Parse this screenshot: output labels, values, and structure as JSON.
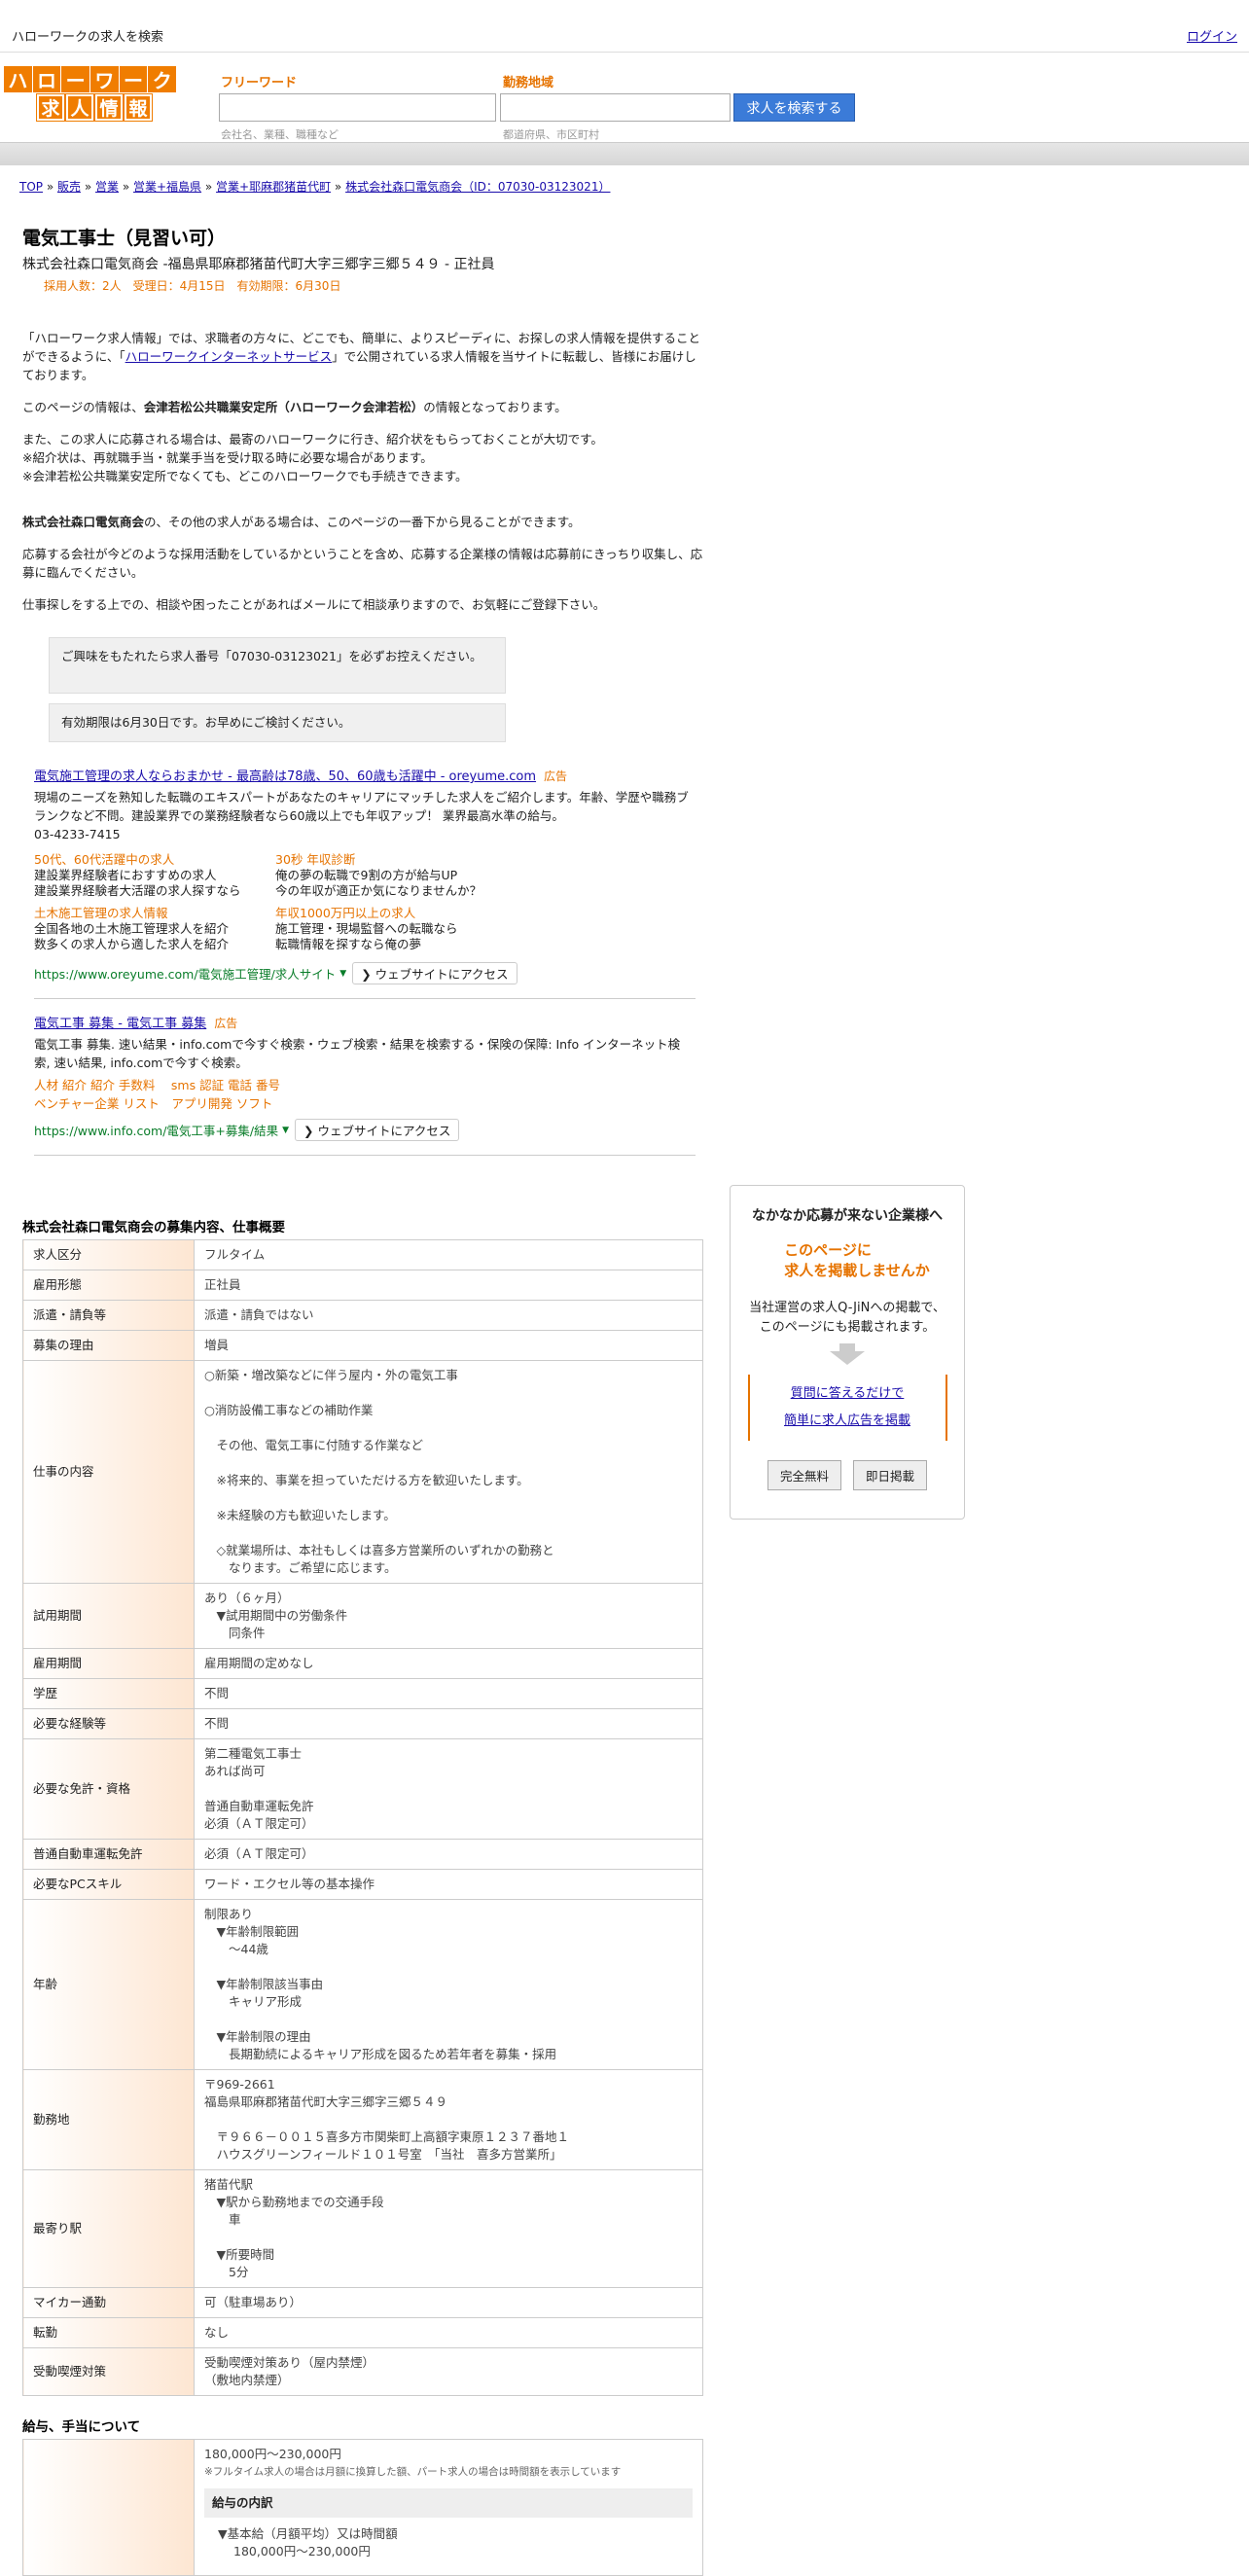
{
  "topbar": {
    "site_title": "ハローワークの求人を検索",
    "login": "ログイン"
  },
  "logo": {
    "row1": [
      "ハ",
      "ロ",
      "ー",
      "ワ",
      "ー",
      "ク"
    ],
    "row2": [
      "求",
      "人",
      "情",
      "報"
    ]
  },
  "search": {
    "freeword_label": "フリーワード",
    "freeword_hint": "会社名、業種、職種など",
    "area_label": "勤務地域",
    "area_hint": "都道府県、市区町村",
    "button": "求人を検索する"
  },
  "breadcrumb": [
    "TOP",
    "販売",
    "営業",
    "営業+福島県",
    "営業+耶麻郡猪苗代町",
    "株式会社森口電気商会（ID：07030-03123021）"
  ],
  "job": {
    "title": "電気工事士（見習い可）",
    "company_line": "株式会社森口電気商会 -福島県耶麻郡猪苗代町大字三郷字三郷５４９ - 正社員",
    "meta": "採用人数：2人　受理日：4月15日　有効期限：6月30日"
  },
  "intro": {
    "p1_a": "「ハローワーク求人情報」では、求職者の方々に、どこでも、簡単に、よりスピーディに、お探しの求人情報を提供することができるように、「",
    "p1_link": "ハローワークインターネットサービス",
    "p1_b": "」で公開されている求人情報を当サイトに転載し、皆様にお届けしております。",
    "p2_a": "このページの情報は、",
    "p2_bold": "会津若松公共職業安定所（ハローワーク会津若松）",
    "p2_b": "の情報となっております。",
    "p3_1": "また、この求人に応募される場合は、最寄のハローワークに行き、紹介状をもらっておくことが大切です。",
    "p3_2": "※紹介状は、再就職手当・就業手当を受け取る時に必要な場合があります。",
    "p3_3": "※会津若松公共職業安定所でなくても、どこのハローワークでも手続きできます。",
    "p4_bold": "株式会社森口電気商会",
    "p4_b": "の、その他の求人がある場合は、このページの一番下から見ることができます。",
    "p5": "応募する会社が今どのような採用活動をしているかということを含め、応募する企業様の情報は応募前にきっちり収集し、応募に臨んでください。",
    "p6": "仕事探しをする上での、相談や困ったことがあればメールにて相談承りますので、お気軽にご登録下さい。"
  },
  "notices": [
    "ご興味をもたれたら求人番号「07030-03123021」を必ずお控えください。",
    "有効期限は6月30日です。お早めにご検討ください。"
  ],
  "ad1": {
    "title": "電気施工管理の求人ならおまかせ - 最高齢は78歳、50、60歳も活躍中 - oreyume.com",
    "badge": "広告",
    "body": "現場のニーズを熟知した転職のエキスパートがあなたのキャリアにマッチした求人をご紹介します。年齢、学歴や職務ブランクなど不問。建設業界での業務経験者なら60歳以上でも年収アップ！ 業界最高水準の給与。",
    "phone": "03-4233-7415",
    "grid": [
      {
        "h": "50代、60代活躍中の求人",
        "t1": "建設業界経験者におすすめの求人",
        "t2": "建設業界経験者大活躍の求人探すなら"
      },
      {
        "h": "30秒 年収診断",
        "t1": "俺の夢の転職で9割の方が給与UP",
        "t2": "今の年収が適正か気になりませんか？"
      },
      {
        "h": "土木施工管理の求人情報",
        "t1": "全国各地の土木施工管理求人を紹介",
        "t2": "数多くの求人から適した求人を紹介"
      },
      {
        "h": "年収1000万円以上の求人",
        "t1": "施工管理・現場監督への転職なら",
        "t2": "転職情報を探すなら俺の夢"
      }
    ],
    "url": "https://www.oreyume.com/電気施工管理/求人サイト",
    "visit": "❯ ウェブサイトにアクセス"
  },
  "ad2": {
    "title": "電気工事 募集 - 電気工事 募集",
    "badge": "広告",
    "body": "電気工事 募集. 速い結果・info.comで今すぐ検索・ウェブ検索・結果を検索する・保険の保障: Info インターネット検索, 速い結果, info.comで今すぐ検索。",
    "links1": "人材 紹介 紹介 手数料　 sms 認証 電話 番号",
    "links2": "ベンチャー企業 リスト　アプリ開発 ソフト",
    "url": "https://www.info.com/電気工事+募集/結果",
    "visit": "❯ ウェブサイトにアクセス"
  },
  "table": {
    "title": "株式会社森口電気商会の募集内容、仕事概要",
    "rows": [
      {
        "label": "求人区分",
        "value": "フルタイム"
      },
      {
        "label": "雇用形態",
        "value": "正社員"
      },
      {
        "label": "派遣・請負等",
        "value": "派遣・請負ではない"
      },
      {
        "label": "募集の理由",
        "value": "増員"
      },
      {
        "label": "仕事の内容",
        "value": "○新築・増改築などに伴う屋内・外の電気工事\n\n○消防設備工事などの補助作業\n\n　その他、電気工事に付随する作業など\n\n　※将来的、事業を担っていただける方を歓迎いたします。\n\n　※未経験の方も歓迎いたします。\n\n　◇就業場所は、本社もしくは喜多方営業所のいずれかの勤務と\n　　なります。ご希望に応じます。"
      },
      {
        "label": "試用期間",
        "value": "あり（６ヶ月）\n　▼試用期間中の労働条件\n　　同条件"
      },
      {
        "label": "雇用期間",
        "value": "雇用期間の定めなし"
      },
      {
        "label": "学歴",
        "value": "不問"
      },
      {
        "label": "必要な経験等",
        "value": "不問"
      },
      {
        "label": "必要な免許・資格",
        "value": "第二種電気工事士\nあれば尚可\n\n普通自動車運転免許\n必須（ＡＴ限定可）\n"
      },
      {
        "label": "普通自動車運転免許",
        "value": "必須（ＡＴ限定可）"
      },
      {
        "label": "必要なPCスキル",
        "value": "ワード・エクセル等の基本操作"
      },
      {
        "label": "年齢",
        "value": "制限あり\n　▼年齢制限範囲\n　　〜44歳\n\n　▼年齢制限該当事由\n　　キャリア形成\n\n　▼年齢制限の理由\n　　長期勤続によるキャリア形成を図るため若年者を募集・採用"
      },
      {
        "label": "勤務地",
        "value": "〒969-2661\n福島県耶麻郡猪苗代町大字三郷字三郷５４９\n\n　〒９６６－００１５喜多方市関柴町上高額字東原１２３７番地１\n　ハウスグリーンフィールド１０１号室　「当社　喜多方営業所」"
      },
      {
        "label": "最寄り駅",
        "value": "猪苗代駅\n　▼駅から勤務地までの交通手段\n　　車\n\n　▼所要時間\n　　5分"
      },
      {
        "label": "マイカー通勤",
        "value": "可（駐車場あり）"
      },
      {
        "label": "転勤",
        "value": "なし"
      },
      {
        "label": "受動喫煙対策",
        "value": "受動喫煙対策あり（屋内禁煙）\n（敷地内禁煙）"
      }
    ]
  },
  "pay": {
    "title": "給与、手当について",
    "range": "180,000円〜230,000円",
    "note": "※フルタイム求人の場合は月額に換算した額、パート求人の場合は時間額を表示しています",
    "inner_title": "給与の内訳",
    "item1": "▼基本給（月額平均）又は時間額",
    "item2": "180,000円〜230,000円"
  },
  "sidebox": {
    "title": "なかなか応募が来ない企業様へ",
    "orange1": "このページに",
    "orange2": "求人を掲載しませんか",
    "text1": "当社運営の求人Q-JiNへの掲載で、",
    "text2": "このページにも掲載されます。",
    "link1": "質問に答えるだけで",
    "link2": "簡単に求人広告を掲載",
    "btn1": "完全無料",
    "btn2": "即日掲載"
  }
}
